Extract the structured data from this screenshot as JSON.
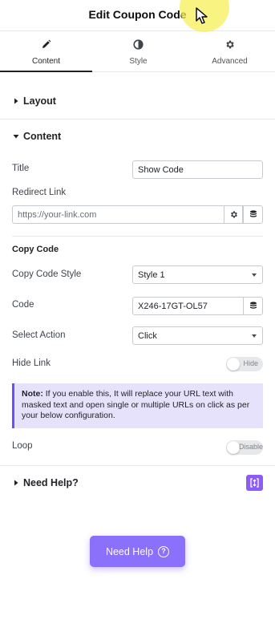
{
  "header": {
    "title": "Edit Coupon Code"
  },
  "tabs": [
    {
      "label": "Content",
      "icon": "pencil-icon",
      "active": true
    },
    {
      "label": "Style",
      "icon": "contrast-icon",
      "active": false
    },
    {
      "label": "Advanced",
      "icon": "gear-icon",
      "active": false
    }
  ],
  "sections": {
    "layout": {
      "label": "Layout",
      "expanded": false
    },
    "content": {
      "label": "Content",
      "expanded": true
    },
    "need_help": {
      "label": "Need Help?",
      "expanded": false
    }
  },
  "content": {
    "title": {
      "label": "Title",
      "value": "Show Code"
    },
    "redirect_link": {
      "label": "Redirect Link",
      "placeholder": "https://your-link.com"
    },
    "copy_code_heading": "Copy Code",
    "copy_code_style": {
      "label": "Copy Code Style",
      "value": "Style 1"
    },
    "code": {
      "label": "Code",
      "value": "X246-17GT-OL57"
    },
    "select_action": {
      "label": "Select Action",
      "value": "Click"
    },
    "hide_link": {
      "label": "Hide Link",
      "toggle_text": "Hide",
      "on": false
    },
    "note": {
      "prefix": "Note:",
      "text": " If you enable this, It will replace your URL text with masked text and open single or multiple URLs on click as per your below configuration."
    },
    "loop": {
      "label": "Loop",
      "toggle_text": "Disable",
      "on": false
    }
  },
  "help_button": {
    "label": "Need Help"
  },
  "colors": {
    "accent": "#8b70fb",
    "note_bg": "#e6e2fb",
    "note_border": "#6d4ff7",
    "badge": "#8b5cf6",
    "cursor_highlight": "#f6f050"
  }
}
